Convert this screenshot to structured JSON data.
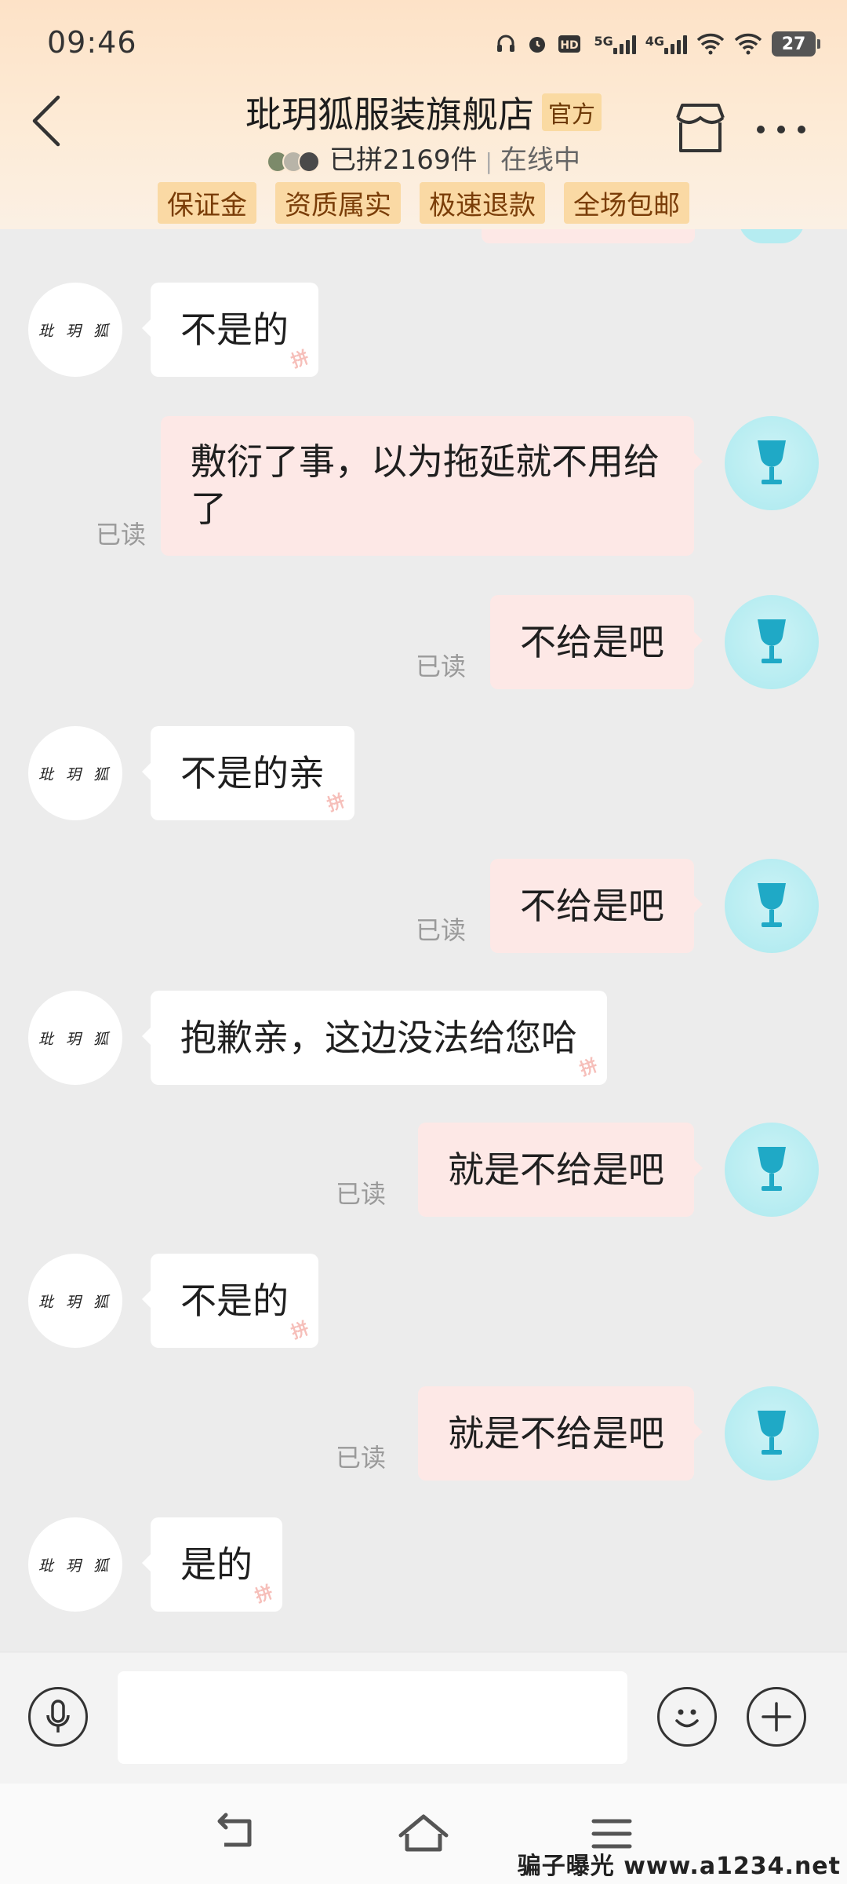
{
  "status_bar": {
    "time": "09:46",
    "sig1_label": "5G",
    "sig2_label": "4G",
    "battery": "27",
    "hd_label": "HD"
  },
  "header": {
    "shop_name": "玭玥狐服装旗舰店",
    "official_badge": "官方",
    "sold_text": "已拼2169件",
    "separator": "|",
    "online_status": "在线中",
    "tags": [
      "保证金",
      "资质属实",
      "极速退款",
      "全场包邮"
    ]
  },
  "shop_avatar_text": "玭 玥 狐",
  "messages": [
    {
      "side": "left",
      "text": "不是的"
    },
    {
      "side": "right",
      "text": "敷衍了事，以为拖延就不用给了",
      "read": "已读"
    },
    {
      "side": "right",
      "text": "不给是吧",
      "read": "已读"
    },
    {
      "side": "left",
      "text": "不是的亲"
    },
    {
      "side": "right",
      "text": "不给是吧",
      "read": "已读"
    },
    {
      "side": "left",
      "text": "抱歉亲，这边没法给您哈"
    },
    {
      "side": "right",
      "text": "就是不给是吧",
      "read": "已读"
    },
    {
      "side": "left",
      "text": "不是的"
    },
    {
      "side": "right",
      "text": "就是不给是吧",
      "read": "已读"
    },
    {
      "side": "left",
      "text": "是的"
    }
  ],
  "pin_mark": "拼",
  "input": {
    "placeholder": ""
  },
  "watermark": "骗子曝光 www.a1234.net",
  "icons": {
    "back": "back-arrow-icon",
    "store": "store-icon",
    "more": "more-icon",
    "voice": "microphone-icon",
    "emoji": "emoji-icon",
    "plus": "plus-icon",
    "user_avatar": "wine-glass-icon"
  },
  "colors": {
    "header_bg": "#fde2c7",
    "tag_bg": "#fad9a4",
    "my_bubble": "#fde8e6",
    "chat_bg": "#ececec",
    "user_avatar_glass": "#1fa9c6"
  }
}
